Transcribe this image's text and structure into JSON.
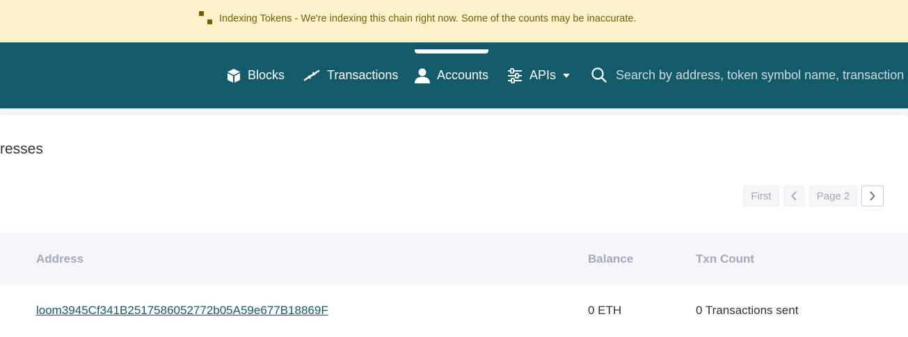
{
  "banner": {
    "title": "Indexing Tokens",
    "message": " - We're indexing this chain right now. Some of the counts may be inaccurate."
  },
  "nav": {
    "items": [
      {
        "label": "Blocks",
        "icon": "cube-icon"
      },
      {
        "label": "Transactions",
        "icon": "arrows-icon"
      },
      {
        "label": "Accounts",
        "icon": "user-icon",
        "active": true
      },
      {
        "label": "APIs",
        "icon": "sliders-icon",
        "dropdown": true
      }
    ],
    "search_placeholder": "Search by address, token symbol name, transaction hash, or block number"
  },
  "page": {
    "title": "resses"
  },
  "pagination": {
    "first_label": "First",
    "page_label": "Page 2"
  },
  "table": {
    "headers": [
      "Address",
      "Balance",
      "Txn Count"
    ],
    "rows": [
      {
        "address": "loom3945Cf341B2517586052772b05A59e677B18869F",
        "balance": "0 ETH",
        "txn_count": "0 Transactions sent"
      }
    ]
  },
  "colors": {
    "navbar": "#135b6b",
    "banner_bg": "#fdf2cc",
    "banner_text": "#7a5c00",
    "header_text": "#a3a9b7",
    "link": "#135b6b"
  }
}
